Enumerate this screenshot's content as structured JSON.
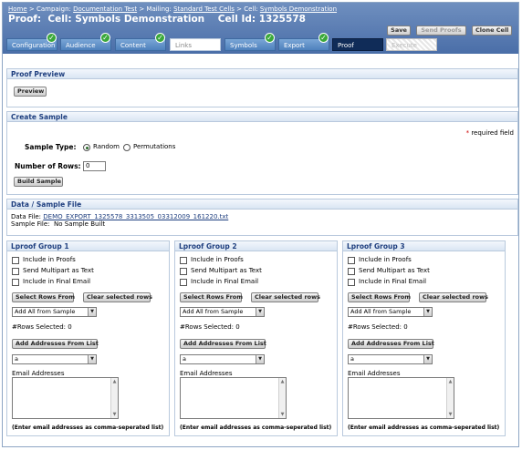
{
  "breadcrumb": {
    "home": "Home",
    "sep1": " > Campaign: ",
    "campaign": "Documentation Test",
    "sep2": " > Mailing: ",
    "mailing": "Standard Test Cells",
    "sep3": " > Cell: ",
    "cell": "Symbols Demonstration"
  },
  "page_title": "Proof:  Cell: Symbols Demonstration    Cell Id: 1325578",
  "header_buttons": {
    "save": "Save",
    "send_proofs": "Send Proofs",
    "clone_cell": "Clone Cell"
  },
  "tabs": [
    {
      "label": "Configuration",
      "state": "done"
    },
    {
      "label": "Audience",
      "state": "done"
    },
    {
      "label": "Content",
      "state": "done"
    },
    {
      "label": "Links",
      "state": "inactive"
    },
    {
      "label": "Symbols",
      "state": "done"
    },
    {
      "label": "Export",
      "state": "done"
    },
    {
      "label": "Proof",
      "state": "active"
    },
    {
      "label": "Execute",
      "state": "disabled"
    }
  ],
  "proof_preview": {
    "title": "Proof Preview",
    "button": "Preview"
  },
  "create_sample": {
    "title": "Create Sample",
    "required_note": "* required field",
    "sample_type_label": "Sample Type:",
    "options": [
      "Random",
      "Permutations"
    ],
    "selected": "Random",
    "rows_label": "Number of Rows:",
    "rows_value": "0",
    "build_button": "Build Sample"
  },
  "data_sample": {
    "title": "Data / Sample File",
    "data_file_label": "Data File: ",
    "data_file": "DEMO_EXPORT_1325578_3313505_03312009_161220.txt",
    "sample_file_label": "Sample File:  ",
    "sample_file": "No Sample Built"
  },
  "groups": [
    {
      "title": "Lproof Group 1",
      "checkboxes": [
        "Include in Proofs",
        "Send Multipart as Text",
        "Include in Final Email"
      ],
      "select_rows": "Select Rows From",
      "clear_rows": "Clear selected rows",
      "dropdown_value": "Add All from Sample",
      "rows_selected": "#Rows Selected: 0",
      "add_addresses": "Add Addresses From List",
      "list_value": "a",
      "email_label": "Email Addresses",
      "email_hint": "(Enter email addresses as comma-seperated list)"
    },
    {
      "title": "Lproof Group 2",
      "checkboxes": [
        "Include in Proofs",
        "Send Multipart as Text",
        "Include in Final Email"
      ],
      "select_rows": "Select Rows From",
      "clear_rows": "Clear selected rows",
      "dropdown_value": "Add All from Sample",
      "rows_selected": "#Rows Selected: 0",
      "add_addresses": "Add Addresses From List",
      "list_value": "a",
      "email_label": "Email Addresses",
      "email_hint": "(Enter email addresses as comma-seperated list)"
    },
    {
      "title": "Lproof Group 3",
      "checkboxes": [
        "Include in Proofs",
        "Send Multipart as Text",
        "Include in Final Email"
      ],
      "select_rows": "Select Rows From",
      "clear_rows": "Clear selected rows",
      "dropdown_value": "Add All from Sample",
      "rows_selected": "#Rows Selected: 0",
      "add_addresses": "Add Addresses From List",
      "list_value": "a",
      "email_label": "Email Addresses",
      "email_hint": "(Enter email addresses as comma-seperated list)"
    }
  ],
  "colors": {
    "header_blue": "#4a6ea8",
    "tab_blue": "#4f81bd",
    "active_tab": "#102c58",
    "section_title": "#1f3f7f",
    "check_green": "#3aa83a",
    "required_red": "#cc0000"
  }
}
